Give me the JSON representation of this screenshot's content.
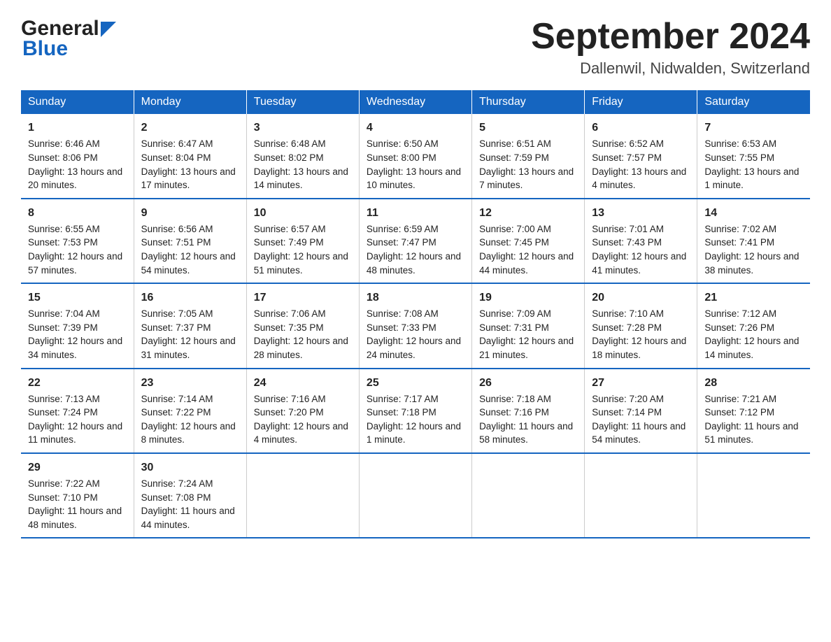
{
  "logo": {
    "general": "General",
    "blue": "Blue"
  },
  "title": "September 2024",
  "subtitle": "Dallenwil, Nidwalden, Switzerland",
  "weekdays": [
    "Sunday",
    "Monday",
    "Tuesday",
    "Wednesday",
    "Thursday",
    "Friday",
    "Saturday"
  ],
  "weeks": [
    [
      {
        "day": "1",
        "sunrise": "Sunrise: 6:46 AM",
        "sunset": "Sunset: 8:06 PM",
        "daylight": "Daylight: 13 hours and 20 minutes."
      },
      {
        "day": "2",
        "sunrise": "Sunrise: 6:47 AM",
        "sunset": "Sunset: 8:04 PM",
        "daylight": "Daylight: 13 hours and 17 minutes."
      },
      {
        "day": "3",
        "sunrise": "Sunrise: 6:48 AM",
        "sunset": "Sunset: 8:02 PM",
        "daylight": "Daylight: 13 hours and 14 minutes."
      },
      {
        "day": "4",
        "sunrise": "Sunrise: 6:50 AM",
        "sunset": "Sunset: 8:00 PM",
        "daylight": "Daylight: 13 hours and 10 minutes."
      },
      {
        "day": "5",
        "sunrise": "Sunrise: 6:51 AM",
        "sunset": "Sunset: 7:59 PM",
        "daylight": "Daylight: 13 hours and 7 minutes."
      },
      {
        "day": "6",
        "sunrise": "Sunrise: 6:52 AM",
        "sunset": "Sunset: 7:57 PM",
        "daylight": "Daylight: 13 hours and 4 minutes."
      },
      {
        "day": "7",
        "sunrise": "Sunrise: 6:53 AM",
        "sunset": "Sunset: 7:55 PM",
        "daylight": "Daylight: 13 hours and 1 minute."
      }
    ],
    [
      {
        "day": "8",
        "sunrise": "Sunrise: 6:55 AM",
        "sunset": "Sunset: 7:53 PM",
        "daylight": "Daylight: 12 hours and 57 minutes."
      },
      {
        "day": "9",
        "sunrise": "Sunrise: 6:56 AM",
        "sunset": "Sunset: 7:51 PM",
        "daylight": "Daylight: 12 hours and 54 minutes."
      },
      {
        "day": "10",
        "sunrise": "Sunrise: 6:57 AM",
        "sunset": "Sunset: 7:49 PM",
        "daylight": "Daylight: 12 hours and 51 minutes."
      },
      {
        "day": "11",
        "sunrise": "Sunrise: 6:59 AM",
        "sunset": "Sunset: 7:47 PM",
        "daylight": "Daylight: 12 hours and 48 minutes."
      },
      {
        "day": "12",
        "sunrise": "Sunrise: 7:00 AM",
        "sunset": "Sunset: 7:45 PM",
        "daylight": "Daylight: 12 hours and 44 minutes."
      },
      {
        "day": "13",
        "sunrise": "Sunrise: 7:01 AM",
        "sunset": "Sunset: 7:43 PM",
        "daylight": "Daylight: 12 hours and 41 minutes."
      },
      {
        "day": "14",
        "sunrise": "Sunrise: 7:02 AM",
        "sunset": "Sunset: 7:41 PM",
        "daylight": "Daylight: 12 hours and 38 minutes."
      }
    ],
    [
      {
        "day": "15",
        "sunrise": "Sunrise: 7:04 AM",
        "sunset": "Sunset: 7:39 PM",
        "daylight": "Daylight: 12 hours and 34 minutes."
      },
      {
        "day": "16",
        "sunrise": "Sunrise: 7:05 AM",
        "sunset": "Sunset: 7:37 PM",
        "daylight": "Daylight: 12 hours and 31 minutes."
      },
      {
        "day": "17",
        "sunrise": "Sunrise: 7:06 AM",
        "sunset": "Sunset: 7:35 PM",
        "daylight": "Daylight: 12 hours and 28 minutes."
      },
      {
        "day": "18",
        "sunrise": "Sunrise: 7:08 AM",
        "sunset": "Sunset: 7:33 PM",
        "daylight": "Daylight: 12 hours and 24 minutes."
      },
      {
        "day": "19",
        "sunrise": "Sunrise: 7:09 AM",
        "sunset": "Sunset: 7:31 PM",
        "daylight": "Daylight: 12 hours and 21 minutes."
      },
      {
        "day": "20",
        "sunrise": "Sunrise: 7:10 AM",
        "sunset": "Sunset: 7:28 PM",
        "daylight": "Daylight: 12 hours and 18 minutes."
      },
      {
        "day": "21",
        "sunrise": "Sunrise: 7:12 AM",
        "sunset": "Sunset: 7:26 PM",
        "daylight": "Daylight: 12 hours and 14 minutes."
      }
    ],
    [
      {
        "day": "22",
        "sunrise": "Sunrise: 7:13 AM",
        "sunset": "Sunset: 7:24 PM",
        "daylight": "Daylight: 12 hours and 11 minutes."
      },
      {
        "day": "23",
        "sunrise": "Sunrise: 7:14 AM",
        "sunset": "Sunset: 7:22 PM",
        "daylight": "Daylight: 12 hours and 8 minutes."
      },
      {
        "day": "24",
        "sunrise": "Sunrise: 7:16 AM",
        "sunset": "Sunset: 7:20 PM",
        "daylight": "Daylight: 12 hours and 4 minutes."
      },
      {
        "day": "25",
        "sunrise": "Sunrise: 7:17 AM",
        "sunset": "Sunset: 7:18 PM",
        "daylight": "Daylight: 12 hours and 1 minute."
      },
      {
        "day": "26",
        "sunrise": "Sunrise: 7:18 AM",
        "sunset": "Sunset: 7:16 PM",
        "daylight": "Daylight: 11 hours and 58 minutes."
      },
      {
        "day": "27",
        "sunrise": "Sunrise: 7:20 AM",
        "sunset": "Sunset: 7:14 PM",
        "daylight": "Daylight: 11 hours and 54 minutes."
      },
      {
        "day": "28",
        "sunrise": "Sunrise: 7:21 AM",
        "sunset": "Sunset: 7:12 PM",
        "daylight": "Daylight: 11 hours and 51 minutes."
      }
    ],
    [
      {
        "day": "29",
        "sunrise": "Sunrise: 7:22 AM",
        "sunset": "Sunset: 7:10 PM",
        "daylight": "Daylight: 11 hours and 48 minutes."
      },
      {
        "day": "30",
        "sunrise": "Sunrise: 7:24 AM",
        "sunset": "Sunset: 7:08 PM",
        "daylight": "Daylight: 11 hours and 44 minutes."
      },
      null,
      null,
      null,
      null,
      null
    ]
  ]
}
